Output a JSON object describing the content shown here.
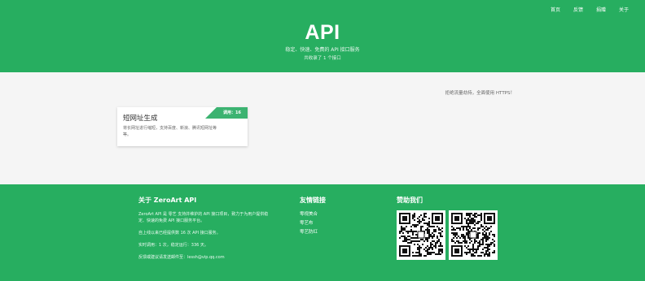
{
  "nav": {
    "items": [
      {
        "label": "首页"
      },
      {
        "label": "反馈"
      },
      {
        "label": "捐赠"
      },
      {
        "label": "关于"
      }
    ]
  },
  "hero": {
    "title": "API",
    "subtitle": "稳定、快速、免费的 API 接口服务",
    "count": "共收录了 1 个接口"
  },
  "notice": "拒绝流量劫持，全面使用 HTTPS！",
  "cards": [
    {
      "badge": "调用：16",
      "title": "短网址生成",
      "description": "将长网址进行缩短，支持百度、新浪、腾讯短网址等等。"
    }
  ],
  "footer": {
    "about": {
      "title": "关于 ZeroArt API",
      "intro": "ZeroArt API 是 零艺 支持并维护的 API 接口项目，致力于为用户提供稳定、快速的免费 API 接口服务平台。",
      "stats": "自上线以来已经提供数 16 次 API 接口服务。",
      "realtime": "实时调用：1 次，稳定运行：336 天。",
      "contact": "反馈或建议请发送邮件至：lessh@vip.qq.com"
    },
    "links": {
      "title": "友情链接",
      "items": [
        {
          "label": "零视美合"
        },
        {
          "label": "零艺布"
        },
        {
          "label": "零艺防红"
        }
      ]
    },
    "donate": {
      "title": "赞助我们",
      "qr_codes": [
        {
          "icon": "qr-code-icon"
        },
        {
          "icon": "qr-code-icon"
        }
      ]
    }
  },
  "colors": {
    "brand_green": "#27ae60",
    "badge_green": "#3cb371",
    "content_bg": "#f5f5f5"
  }
}
